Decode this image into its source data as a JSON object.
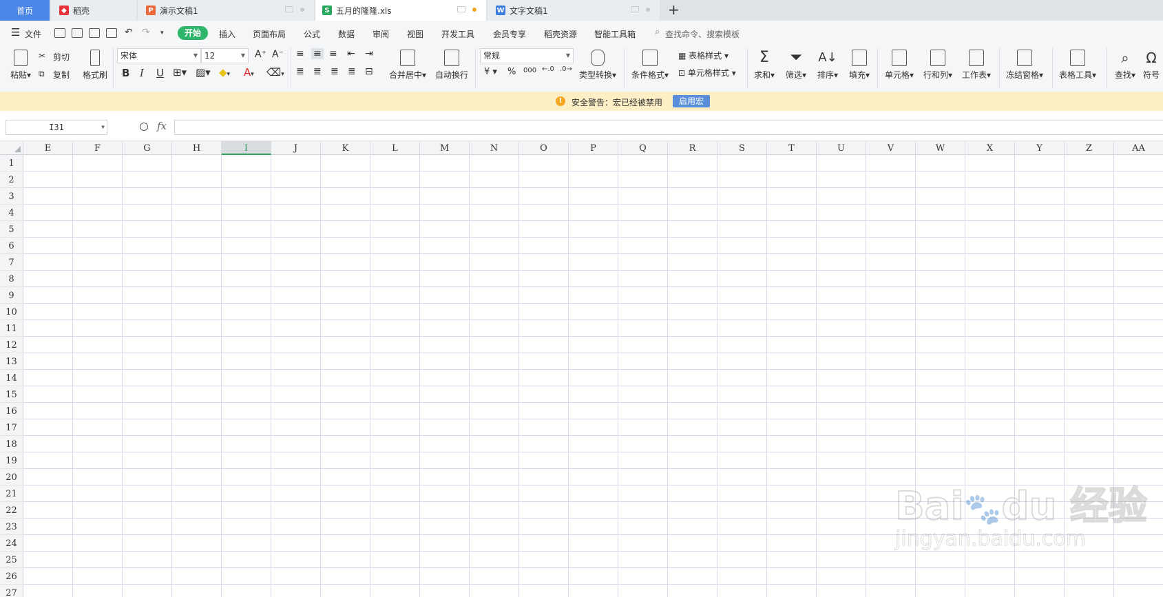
{
  "tabs": {
    "home": "首页",
    "tab1": "稻壳",
    "tab2": "演示文稿1",
    "tab3": "五月的隆隆.xls",
    "tab4": "文字文稿1"
  },
  "menu": {
    "file": "文件",
    "start": "开始",
    "items": [
      "插入",
      "页面布局",
      "公式",
      "数据",
      "审阅",
      "视图",
      "开发工具",
      "会员专享",
      "稻壳资源",
      "智能工具箱"
    ],
    "search": "查找命令、搜索模板"
  },
  "ribbon": {
    "paste": "粘贴",
    "cut": "剪切",
    "copy": "复制",
    "format_painter": "格式刷",
    "font": "宋体",
    "font_size": "12",
    "bold": "B",
    "italic": "I",
    "underline": "U",
    "merge": "合并居中",
    "wrap": "自动换行",
    "number_format": "常规",
    "currency": "¥",
    "percent": "%",
    "thousands": "000",
    "type_convert": "类型转换",
    "cond_format": "条件格式",
    "table_style": "表格样式",
    "cell_style": "单元格样式",
    "sum": "求和",
    "filter": "筛选",
    "sort": "排序",
    "fill": "填充",
    "cells": "单元格",
    "row_col": "行和列",
    "worksheet": "工作表",
    "freeze": "冻结窗格",
    "table_tools": "表格工具",
    "find": "查找",
    "symbol": "符号"
  },
  "warning": {
    "text": "安全警告：宏已经被禁用",
    "button": "启用宏"
  },
  "formula": {
    "cell_ref": "I31",
    "fx": "fx",
    "value": ""
  },
  "columns": [
    "E",
    "F",
    "G",
    "H",
    "I",
    "J",
    "K",
    "L",
    "M",
    "N",
    "O",
    "P",
    "Q",
    "R",
    "S",
    "T",
    "U",
    "V",
    "W",
    "X",
    "Y",
    "Z",
    "AA"
  ],
  "selected_column": "I",
  "rows": [
    "1",
    "2",
    "3",
    "4",
    "5",
    "6",
    "7",
    "8",
    "9",
    "10",
    "11",
    "12",
    "13",
    "14",
    "15",
    "16",
    "17",
    "18",
    "19",
    "20",
    "21",
    "22",
    "23",
    "24",
    "25",
    "26",
    "27"
  ],
  "watermark": {
    "logo": "Bai du 经验",
    "url": "jingyan.baidu.com"
  },
  "colors": {
    "accent_green": "#2eb66a",
    "home_tab": "#4a86e8",
    "warning_bg": "#fcefc6"
  }
}
